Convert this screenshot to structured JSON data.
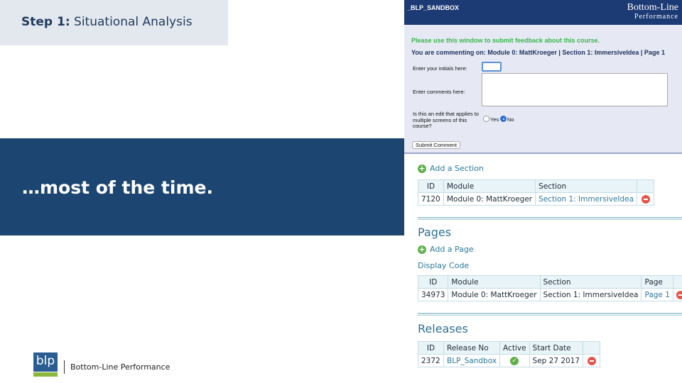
{
  "slide": {
    "step_prefix": "Step 1:",
    "step_title": "Situational Analysis",
    "banner_text": "…most of the time.",
    "logo_mark": "blp",
    "logo_text": "Bottom-Line Performance"
  },
  "panel": {
    "header": {
      "sandbox_label": "_BLP_SANDBOX",
      "brand_line1": "Bottom-Line",
      "brand_line2": "Performance"
    },
    "feedback": {
      "line1": "Please use this window to submit feedback about this course.",
      "line2": "You are commenting on: Module 0: MattKroeger | Section 1: ImmersiveIdea | Page 1",
      "initials_label": "Enter your initials here:",
      "initials_value": "",
      "comments_label": "Enter comments here:",
      "comments_value": "",
      "edit_question": "Is this an edit that applies to multiple screens of this course?",
      "yes_label": "Yes",
      "no_label": "No",
      "selected_option": "No",
      "submit_label": "Submit Comment"
    },
    "sections": {
      "add_label": "Add a Section",
      "columns": [
        "ID",
        "Module",
        "Section"
      ],
      "rows": [
        {
          "id": "7120",
          "module": "Module 0: MattKroeger",
          "section": "Section 1: ImmersiveIdea"
        }
      ]
    },
    "pages": {
      "title": "Pages",
      "add_label": "Add a Page",
      "display_code_label": "Display Code",
      "columns": [
        "ID",
        "Module",
        "Section",
        "Page"
      ],
      "rows": [
        {
          "id": "34973",
          "module": "Module 0: MattKroeger",
          "section": "Section 1: ImmersiveIdea",
          "page": "Page 1"
        }
      ]
    },
    "releases": {
      "title": "Releases",
      "columns": [
        "ID",
        "Release No",
        "Active",
        "Start Date"
      ],
      "rows": [
        {
          "id": "2372",
          "release_no": "BLP_Sandbox",
          "active": true,
          "start_date": "Sep 27 2017"
        }
      ]
    }
  },
  "colors": {
    "banner": "#1c4671",
    "header": "#1c3a73",
    "link": "#2d7a9c",
    "success": "#5fae4a",
    "danger": "#e2574c"
  },
  "icons": {
    "add": "plus-circle-icon",
    "delete": "minus-circle-icon",
    "active": "check-circle-icon"
  }
}
